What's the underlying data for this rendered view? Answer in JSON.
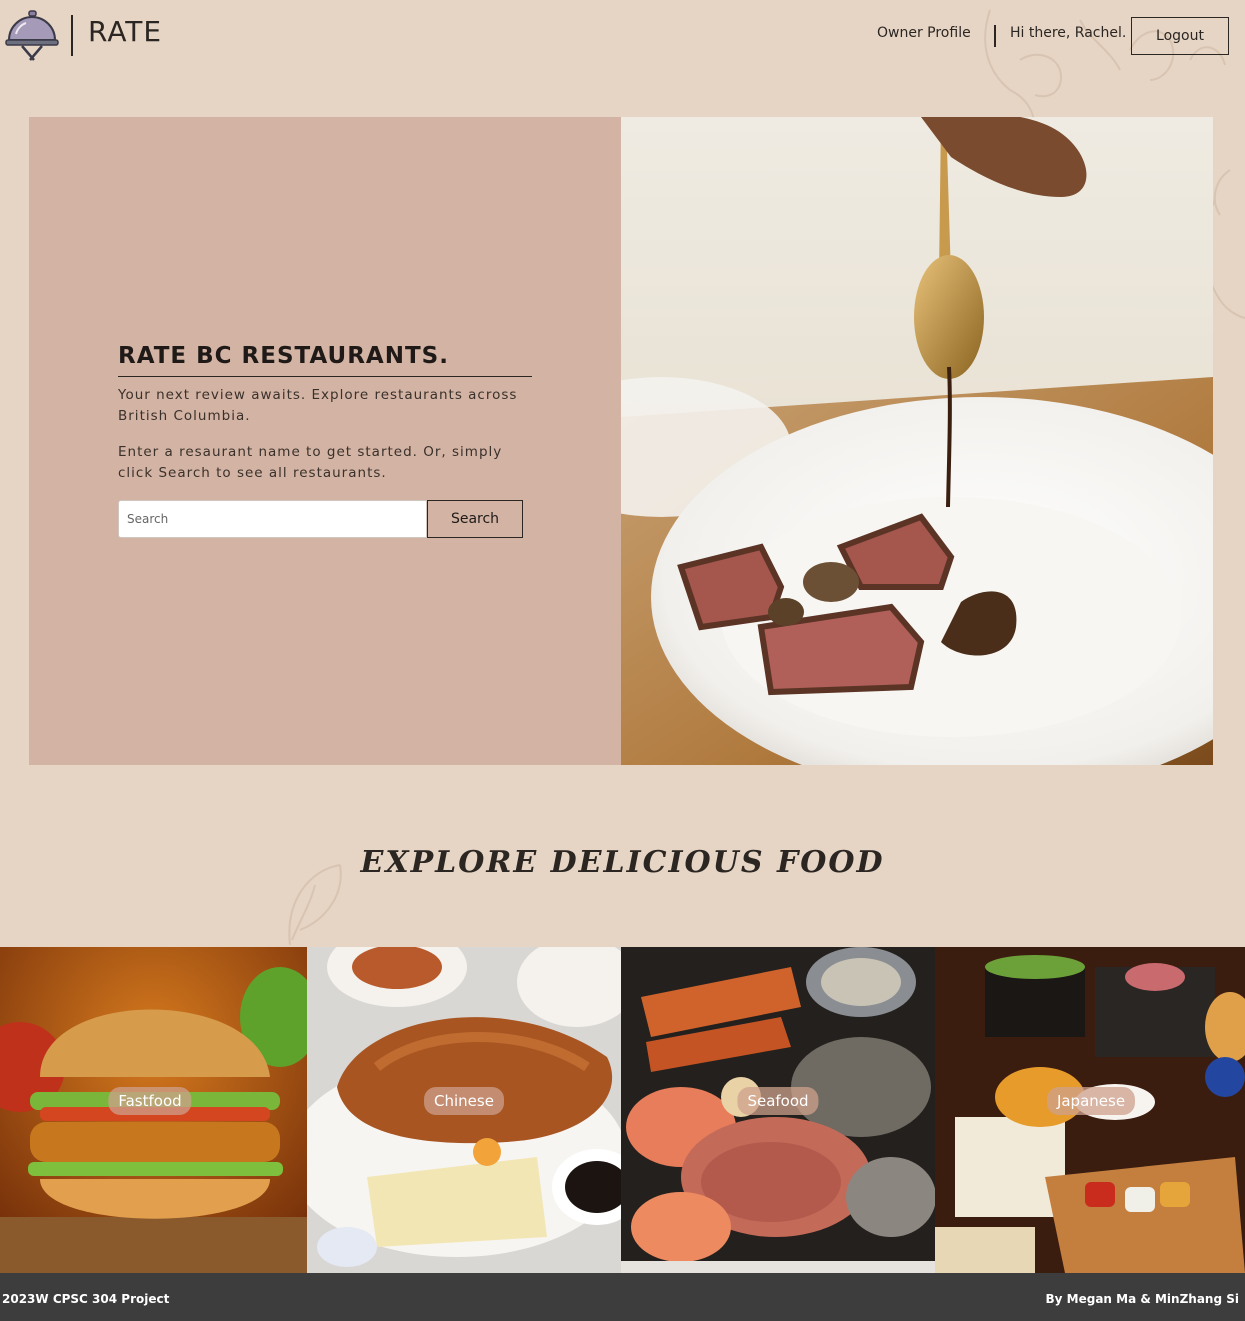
{
  "header": {
    "brand": "RATE",
    "logo_icon": "cloche-icon",
    "nav": {
      "owner_profile": "Owner Profile",
      "greeting": "Hi there, Rachel.",
      "logout": "Logout"
    }
  },
  "hero": {
    "title": "RATE BC RESTAURANTS.",
    "intro": "Your next review awaits. Explore restaurants across British Columbia.",
    "instructions": "Enter a resaurant name to get started. Or, simply click Search to see all restaurants.",
    "search": {
      "placeholder": "Search",
      "value": "",
      "button_label": "Search"
    },
    "photo": "plated steak with sauce drizzled from spoon"
  },
  "explore": {
    "title": "EXPLORE DELICIOUS FOOD",
    "categories": [
      {
        "label": "Fastfood",
        "image": "burger"
      },
      {
        "label": "Chinese",
        "image": "roast duck"
      },
      {
        "label": "Seafood",
        "image": "seafood platter"
      },
      {
        "label": "Japanese",
        "image": "japanese set meal"
      }
    ]
  },
  "footer": {
    "left": "2023W CPSC 304 Project",
    "right": "By Megan Ma & MinZhang Si"
  },
  "colors": {
    "page_bg": "#e6d5c5",
    "hero_panel": "#d3b3a3",
    "footer_bg": "#3d3d3e",
    "text": "#2b2622"
  }
}
